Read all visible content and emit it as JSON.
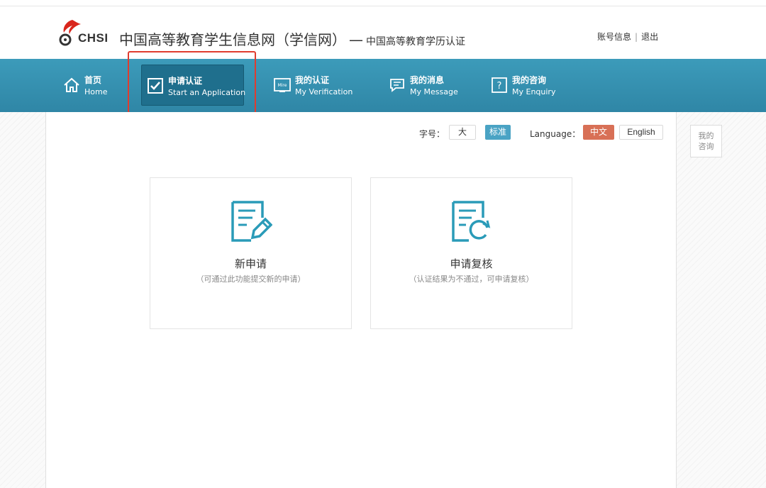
{
  "header": {
    "logo_text": "CHSI",
    "site_title": "中国高等教育学生信息网（学信网）",
    "title_separator": "—",
    "site_subtitle": "中国高等教育学历认证",
    "account_info": "账号信息",
    "logout": "退出"
  },
  "nav": {
    "items": [
      {
        "zh": "首页",
        "en": "Home",
        "icon": "home-icon"
      },
      {
        "zh": "申请认证",
        "en": "Start an Application",
        "icon": "checkbox-icon",
        "active": true
      },
      {
        "zh": "我的认证",
        "en": "My Verification",
        "icon": "certificate-icon"
      },
      {
        "zh": "我的消息",
        "en": "My Message",
        "icon": "message-icon"
      },
      {
        "zh": "我的咨询",
        "en": "My Enquiry",
        "icon": "question-icon"
      }
    ]
  },
  "toolbar": {
    "font_size_label": "字号：",
    "font_large": "大",
    "font_standard": "标准",
    "language_label": "Language：",
    "lang_zh": "中文",
    "lang_en": "English"
  },
  "cards": [
    {
      "title": "新申请",
      "desc": "（可通过此功能提交新的申请）",
      "icon": "edit-document-icon"
    },
    {
      "title": "申请复核",
      "desc": "（认证结果为不通过，可申请复核）",
      "icon": "refresh-document-icon"
    }
  ],
  "side": {
    "enquiry_line1": "我的",
    "enquiry_line2": "咨询"
  },
  "colors": {
    "nav_bg": "#3594b4",
    "nav_active": "#1f6f8d",
    "accent_teal": "#2a9bb8",
    "lang_active": "#d87056",
    "font_active": "#4aa3c4",
    "highlight_red": "#e03c2f"
  }
}
